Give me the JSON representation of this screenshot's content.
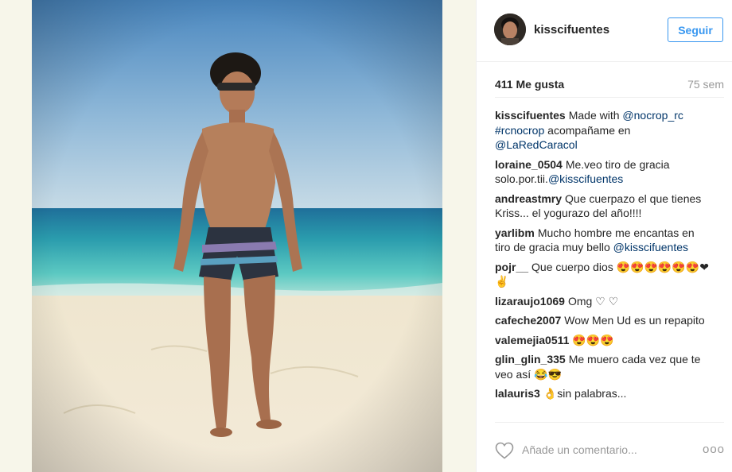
{
  "post": {
    "username": "kisscifuentes",
    "follow_label": "Seguir",
    "likes": "411 Me gusta",
    "time": "75 sem"
  },
  "caption": {
    "user": "kisscifuentes",
    "text": "Made with ",
    "mention1": "@nocrop_rc",
    "tag": "#rcnocrop",
    "text2": " acompañame en ",
    "mention2": "@LaRedCaracol"
  },
  "comments": [
    {
      "user": "loraine_0504",
      "text": "Me.veo tiro de gracia solo.por.tii.",
      "mention": "@kisscifuentes"
    },
    {
      "user": "andreastmry",
      "text": "Que cuerpazo el que tienes Kriss... el yogurazo del año!!!!"
    },
    {
      "user": "yarlibm",
      "text": "Mucho hombre me encantas en tiro de gracia muy bello ",
      "mention": "@kisscifuentes"
    },
    {
      "user": "pojr__",
      "text": "Que cuerpo dios 😍😍😍😍😍😍❤✌"
    },
    {
      "user": "lizaraujo1069",
      "text": "Omg ♡ ♡"
    },
    {
      "user": "cafeche2007",
      "text": "Wow Men Ud es un repapito"
    },
    {
      "user": "valemejia0511",
      "text": "😍😍😍"
    },
    {
      "user": "glin_glin_335",
      "text": "Me muero cada vez que te veo así 😂😎"
    },
    {
      "user": "lalauris3",
      "text": "👌sin palabras..."
    }
  ],
  "composer": {
    "placeholder": "Añade un comentario...",
    "more": "ooo"
  },
  "colors": {
    "link": "#003569",
    "follow": "#3897f0",
    "muted": "#999999"
  },
  "icons": [
    "heart-icon",
    "more-options-icon"
  ]
}
